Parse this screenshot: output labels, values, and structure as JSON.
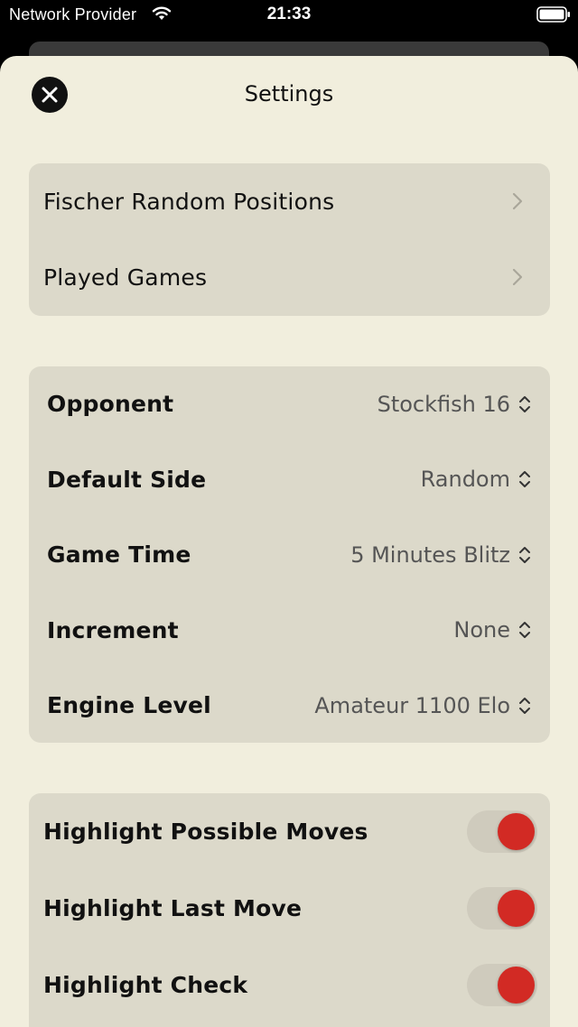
{
  "status_bar": {
    "carrier": "Network Provider",
    "time": "21:33"
  },
  "sheet": {
    "title": "Settings"
  },
  "navigation_group": {
    "items": [
      {
        "label": "Fischer Random Positions"
      },
      {
        "label": "Played Games"
      }
    ]
  },
  "game_group": {
    "items": [
      {
        "label": "Opponent",
        "value": "Stockfish 16"
      },
      {
        "label": "Default Side",
        "value": "Random"
      },
      {
        "label": "Game Time",
        "value": "5 Minutes Blitz"
      },
      {
        "label": "Increment",
        "value": "None"
      },
      {
        "label": "Engine Level",
        "value": "Amateur 1100 Elo"
      }
    ]
  },
  "highlight_group": {
    "items": [
      {
        "label": "Highlight Possible Moves",
        "on": true
      },
      {
        "label": "Highlight Last Move",
        "on": true
      },
      {
        "label": "Highlight Check",
        "on": true
      }
    ]
  },
  "colors": {
    "sheet_background": "#f1eedd",
    "group_background": "#dcd9ca",
    "toggle_accent": "#d22a24"
  }
}
